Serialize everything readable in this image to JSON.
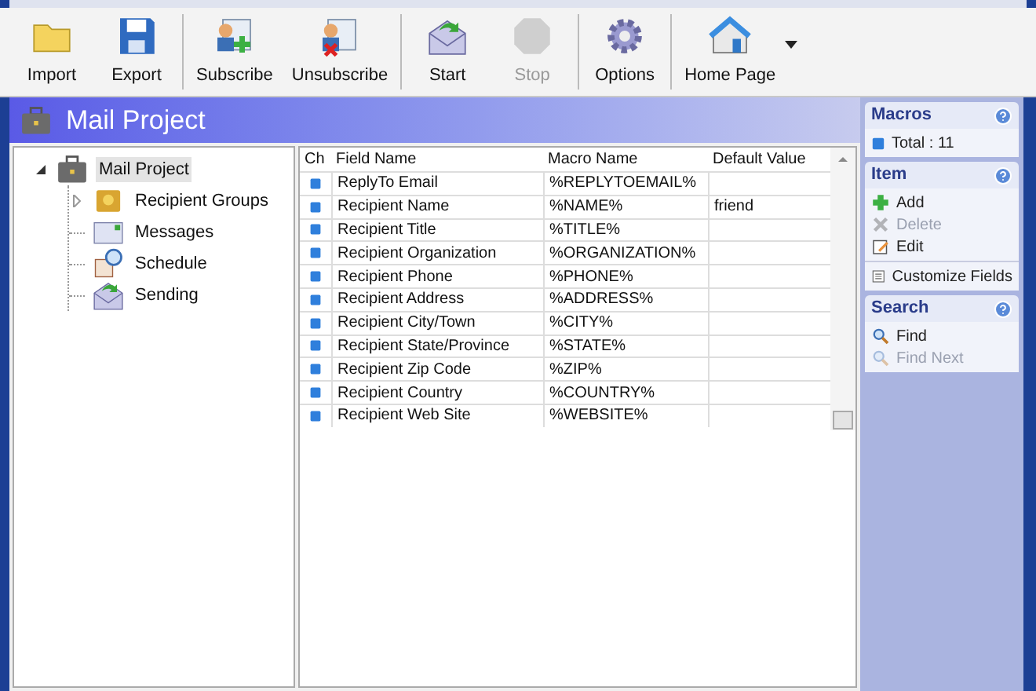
{
  "toolbar": [
    [
      {
        "label": "Import",
        "disabled": false
      },
      {
        "label": "Export",
        "disabled": false
      }
    ],
    [
      {
        "label": "Subscribe",
        "disabled": false
      },
      {
        "label": "Unsubscribe",
        "disabled": false
      }
    ],
    [
      {
        "label": "Start",
        "disabled": false
      },
      {
        "label": "Stop",
        "disabled": true
      }
    ],
    [
      {
        "label": "Options",
        "disabled": false
      }
    ],
    [
      {
        "label": "Home Page",
        "disabled": false,
        "dropdown": true
      }
    ]
  ],
  "header": {
    "title": "Mail Project"
  },
  "tree": [
    {
      "label": "Mail Project",
      "selected": true,
      "expanded": true,
      "children": [
        {
          "label": "Recipient Groups",
          "selected": false,
          "expanded": false
        },
        {
          "label": "Messages",
          "selected": false
        },
        {
          "label": "Schedule",
          "selected": false
        },
        {
          "label": "Sending",
          "selected": false
        }
      ]
    }
  ],
  "table": {
    "columns": [
      "Ch",
      "Field Name",
      "Macro Name",
      "Default Value"
    ],
    "rows": [
      [
        "",
        "ReplyTo Email",
        "%REPLYTOEMAIL%",
        ""
      ],
      [
        "",
        "Recipient Name",
        "%NAME%",
        "friend"
      ],
      [
        "",
        "Recipient Title",
        "%TITLE%",
        ""
      ],
      [
        "",
        "Recipient Organization",
        "%ORGANIZATION%",
        ""
      ],
      [
        "",
        "Recipient Phone",
        "%PHONE%",
        ""
      ],
      [
        "",
        "Recipient Address",
        "%ADDRESS%",
        ""
      ],
      [
        "",
        "Recipient City/Town",
        "%CITY%",
        ""
      ],
      [
        "",
        "Recipient State/Province",
        "%STATE%",
        ""
      ],
      [
        "",
        "Recipient Zip Code",
        "%ZIP%",
        ""
      ],
      [
        "",
        "Recipient Country",
        "%COUNTRY%",
        ""
      ],
      [
        "",
        "Recipient Web Site",
        "%WEBSITE%",
        ""
      ]
    ]
  },
  "side_panels": [
    {
      "title": "Macros",
      "groups": [
        [
          {
            "label": "Total : 11",
            "disabled": false
          }
        ]
      ]
    },
    {
      "title": "Item",
      "groups": [
        [
          {
            "label": "Add",
            "disabled": false
          },
          {
            "label": "Delete",
            "disabled": true
          },
          {
            "label": "Edit",
            "disabled": false
          }
        ],
        [
          {
            "label": "Customize Fields",
            "disabled": false
          }
        ]
      ]
    },
    {
      "title": "Search",
      "groups": [
        [
          {
            "label": "Find",
            "disabled": false
          },
          {
            "label": "Find Next",
            "disabled": true
          }
        ]
      ]
    }
  ]
}
